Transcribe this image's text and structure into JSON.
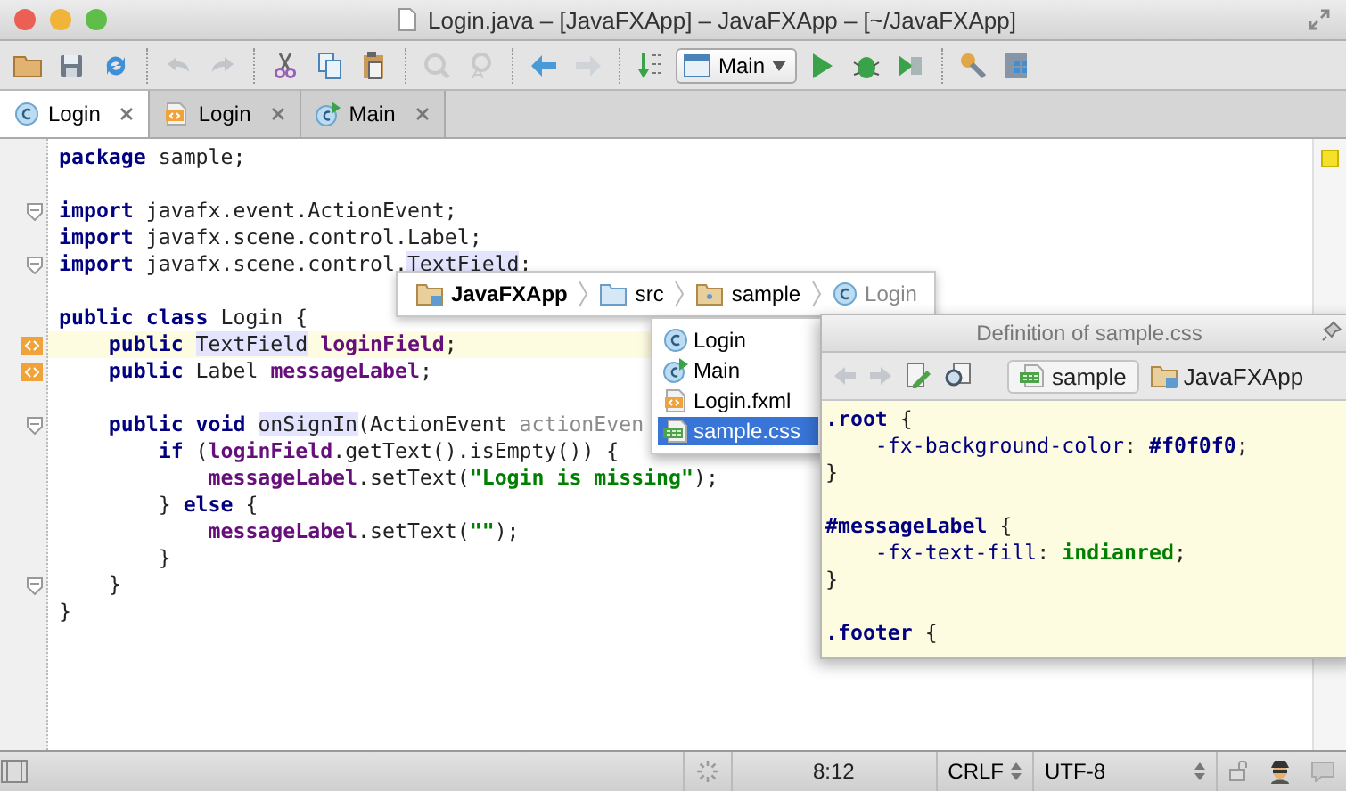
{
  "window": {
    "title": "Login.java – [JavaFXApp] – JavaFXApp – [~/JavaFXApp]"
  },
  "toolbar": [
    {
      "kind": "open",
      "disabled": false
    },
    {
      "kind": "save",
      "disabled": false
    },
    {
      "kind": "sync",
      "disabled": false
    },
    {
      "kind": "sep"
    },
    {
      "kind": "undo",
      "disabled": true
    },
    {
      "kind": "redo",
      "disabled": true
    },
    {
      "kind": "sep"
    },
    {
      "kind": "cut",
      "disabled": false
    },
    {
      "kind": "copy",
      "disabled": false
    },
    {
      "kind": "paste",
      "disabled": false
    },
    {
      "kind": "sep"
    },
    {
      "kind": "find",
      "disabled": true
    },
    {
      "kind": "replace",
      "disabled": true
    },
    {
      "kind": "sep"
    },
    {
      "kind": "back",
      "disabled": false
    },
    {
      "kind": "forward",
      "disabled": true
    },
    {
      "kind": "sep"
    },
    {
      "kind": "binary",
      "disabled": false
    },
    {
      "kind": "config",
      "label": "Main"
    },
    {
      "kind": "run",
      "disabled": false
    },
    {
      "kind": "debug",
      "disabled": false
    },
    {
      "kind": "coverage",
      "disabled": false
    },
    {
      "kind": "sep"
    },
    {
      "kind": "settings",
      "disabled": false
    },
    {
      "kind": "structure",
      "disabled": false
    }
  ],
  "tabs": [
    {
      "label": "Login",
      "kind": "class",
      "selected": true
    },
    {
      "label": "Login",
      "kind": "fxml",
      "selected": false
    },
    {
      "label": "Main",
      "kind": "main",
      "selected": false
    }
  ],
  "editor": {
    "lines": [
      {
        "kind": "plain",
        "current": false,
        "tokens": [
          {
            "kind": "kw",
            "text": "package"
          },
          {
            "kind": "plain",
            "text": " sample;"
          }
        ]
      },
      {
        "kind": "plain",
        "current": false
      },
      {
        "kind": "fold",
        "current": false,
        "tokens": [
          {
            "kind": "kw",
            "text": "import"
          },
          {
            "kind": "plain",
            "text": " javafx.event.ActionEvent;"
          }
        ]
      },
      {
        "kind": "plain",
        "current": false,
        "tokens": [
          {
            "kind": "kw",
            "text": "import"
          },
          {
            "kind": "plain",
            "text": " javafx.scene.control.Label;"
          }
        ]
      },
      {
        "kind": "fold",
        "current": false,
        "tokens": [
          {
            "kind": "kw",
            "text": "import"
          },
          {
            "kind": "plain",
            "text": " javafx.scene.control."
          },
          {
            "kind": "hl",
            "text": "TextField"
          },
          {
            "kind": "plain",
            "text": ";"
          }
        ]
      },
      {
        "kind": "plain",
        "current": false
      },
      {
        "kind": "plain",
        "current": false,
        "tokens": [
          {
            "kind": "kw",
            "text": "public class"
          },
          {
            "kind": "plain",
            "text": " Login {"
          }
        ]
      },
      {
        "kind": "impl",
        "current": true,
        "tokens": [
          {
            "kind": "kw",
            "text": "    public "
          },
          {
            "kind": "hl",
            "text": "TextField"
          },
          {
            "kind": "field",
            "text": " loginField"
          },
          {
            "kind": "plain",
            "text": ";"
          }
        ]
      },
      {
        "kind": "impl",
        "current": false,
        "tokens": [
          {
            "kind": "kw",
            "text": "    public"
          },
          {
            "kind": "plain",
            "text": " Label "
          },
          {
            "kind": "field",
            "text": "messageLabel"
          },
          {
            "kind": "plain",
            "text": ";"
          }
        ]
      },
      {
        "kind": "plain",
        "current": false
      },
      {
        "kind": "fold",
        "current": false,
        "tokens": [
          {
            "kind": "kw",
            "text": "    public void "
          },
          {
            "kind": "hl",
            "text": "onSignIn"
          },
          {
            "kind": "plain",
            "text": "(ActionEvent "
          },
          {
            "kind": "hint",
            "text": "actionEven"
          }
        ]
      },
      {
        "kind": "plain",
        "current": false,
        "tokens": [
          {
            "kind": "kw",
            "text": "        if"
          },
          {
            "kind": "plain",
            "text": " ("
          },
          {
            "kind": "field",
            "text": "loginField"
          },
          {
            "kind": "plain",
            "text": ".getText().isEmpty()) {"
          }
        ]
      },
      {
        "kind": "plain",
        "current": false,
        "tokens": [
          {
            "kind": "field",
            "text": "            messageLabel"
          },
          {
            "kind": "plain",
            "text": ".setText("
          },
          {
            "kind": "str",
            "text": "\"Login is missing\""
          },
          {
            "kind": "plain",
            "text": ");"
          }
        ]
      },
      {
        "kind": "plain",
        "current": false,
        "tokens": [
          {
            "kind": "plain",
            "text": "        } "
          },
          {
            "kind": "kw",
            "text": "else"
          },
          {
            "kind": "plain",
            "text": " {"
          }
        ]
      },
      {
        "kind": "plain",
        "current": false,
        "tokens": [
          {
            "kind": "field",
            "text": "            messageLabel"
          },
          {
            "kind": "plain",
            "text": ".setText("
          },
          {
            "kind": "str",
            "text": "\"\""
          },
          {
            "kind": "plain",
            "text": ");"
          }
        ]
      },
      {
        "kind": "plain",
        "current": false,
        "tokens": [
          {
            "kind": "plain",
            "text": "        }"
          }
        ]
      },
      {
        "kind": "fold",
        "current": false,
        "tokens": [
          {
            "kind": "plain",
            "text": "    }"
          }
        ]
      },
      {
        "kind": "plain",
        "current": false,
        "tokens": [
          {
            "kind": "plain",
            "text": "}"
          }
        ]
      }
    ]
  },
  "breadcrumb": [
    {
      "label": "JavaFXApp",
      "kind": "module",
      "bold": true,
      "dim": false
    },
    {
      "label": "src",
      "kind": "folder",
      "bold": false,
      "dim": false
    },
    {
      "label": "sample",
      "kind": "package",
      "bold": false,
      "dim": false
    },
    {
      "label": "Login",
      "kind": "class",
      "bold": false,
      "dim": true
    }
  ],
  "dropdown": [
    {
      "label": "Login",
      "kind": "class",
      "selected": false
    },
    {
      "label": "Main",
      "kind": "main",
      "selected": false
    },
    {
      "label": "Login.fxml",
      "kind": "fxml",
      "selected": false
    },
    {
      "label": "sample.css",
      "kind": "css",
      "selected": true
    }
  ],
  "definition": {
    "title": "Definition of sample.css",
    "file": "sample",
    "module": "JavaFXApp",
    "lines": [
      {
        "kind": "code",
        "tokens": [
          {
            "kind": "kw",
            "text": ".root"
          },
          {
            "kind": "plain",
            "text": " {"
          }
        ]
      },
      {
        "kind": "code",
        "tokens": [
          {
            "kind": "prop",
            "text": "    -fx-background-color"
          },
          {
            "kind": "plain",
            "text": ": "
          },
          {
            "kind": "kw",
            "text": "#f0f0f0"
          },
          {
            "kind": "plain",
            "text": ";"
          }
        ]
      },
      {
        "kind": "code",
        "tokens": [
          {
            "kind": "plain",
            "text": "}"
          }
        ]
      },
      {
        "kind": "blank"
      },
      {
        "kind": "code",
        "tokens": [
          {
            "kind": "kw",
            "text": "#messageLabel"
          },
          {
            "kind": "plain",
            "text": " {"
          }
        ]
      },
      {
        "kind": "code",
        "tokens": [
          {
            "kind": "prop",
            "text": "    -fx-text-fill"
          },
          {
            "kind": "plain",
            "text": ": "
          },
          {
            "kind": "str",
            "text": "indianred"
          },
          {
            "kind": "plain",
            "text": ";"
          }
        ]
      },
      {
        "kind": "code",
        "tokens": [
          {
            "kind": "plain",
            "text": "}"
          }
        ]
      },
      {
        "kind": "blank"
      },
      {
        "kind": "code",
        "tokens": [
          {
            "kind": "kw",
            "text": ".footer"
          },
          {
            "kind": "plain",
            "text": " {"
          }
        ]
      }
    ]
  },
  "status_bar": {
    "position": "8:12",
    "line_separator": "CRLF",
    "encoding": "UTF-8"
  }
}
